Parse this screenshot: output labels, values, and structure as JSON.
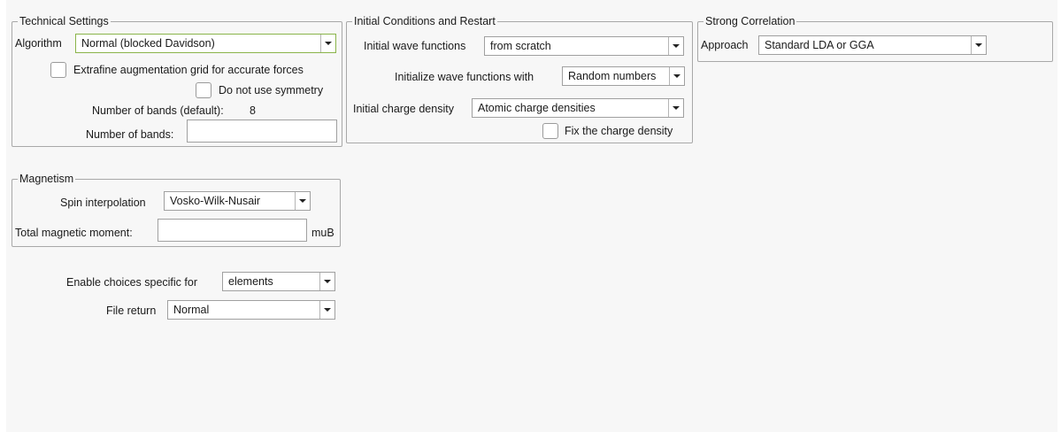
{
  "technical": {
    "legend": "Technical Settings",
    "algorithm_label": "Algorithm",
    "algorithm_value": "Normal (blocked Davidson)",
    "extrafine_label": "Extrafine augmentation grid for accurate forces",
    "nosym_label": "Do not use symmetry",
    "bands_default_label": "Number of bands (default):",
    "bands_default_value": "8",
    "bands_label": "Number of bands:",
    "bands_value": ""
  },
  "initial": {
    "legend": "Initial Conditions and Restart",
    "wave_label": "Initial wave functions",
    "wave_value": "from scratch",
    "init_with_label": "Initialize wave functions with",
    "init_with_value": "Random numbers",
    "charge_label": "Initial charge density",
    "charge_value": "Atomic charge densities",
    "fix_label": "Fix the charge density"
  },
  "correlation": {
    "legend": "Strong Correlation",
    "approach_label": "Approach",
    "approach_value": "Standard LDA or GGA"
  },
  "magnetism": {
    "legend": "Magnetism",
    "spin_label": "Spin interpolation",
    "spin_value": "Vosko-Wilk-Nusair",
    "moment_label": "Total magnetic moment:",
    "moment_value": "",
    "moment_unit": "muB"
  },
  "misc": {
    "enable_label": "Enable choices specific for",
    "enable_value": "elements",
    "file_return_label": "File return",
    "file_return_value": "Normal"
  }
}
